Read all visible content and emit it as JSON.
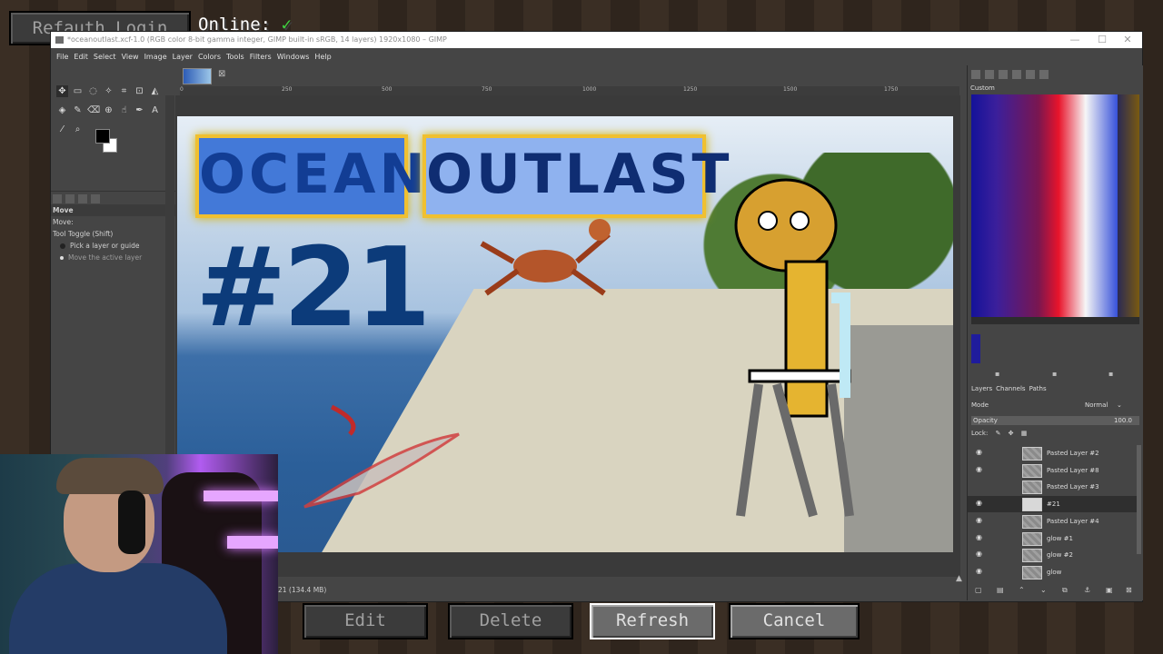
{
  "minecraft": {
    "top_button": "Refauth Login",
    "online_label": "Online:",
    "online_check": "✓",
    "buttons": {
      "edit": "Edit",
      "delete": "Delete",
      "refresh": "Refresh",
      "cancel": "Cancel"
    }
  },
  "gimp": {
    "title": "*oceanoutlast.xcf-1.0 (RGB color 8-bit gamma integer, GIMP built-in sRGB, 14 layers) 1920x1080 – GIMP",
    "window_controls": [
      "—",
      "☐",
      "✕"
    ],
    "menu": [
      "File",
      "Edit",
      "Select",
      "View",
      "Image",
      "Layer",
      "Colors",
      "Tools",
      "Filters",
      "Windows",
      "Help"
    ],
    "tool_options": {
      "header": "Move",
      "move_label": "Move:",
      "toggle": "Tool Toggle (Shift)",
      "opt1": "Pick a layer or guide",
      "opt2": "Move the active layer"
    },
    "ruler_marks": [
      "0",
      "250",
      "500",
      "750",
      "1000",
      "1250",
      "1500",
      "1750"
    ],
    "image": {
      "title_left": "OCEAN",
      "title_right": "OUTLAST",
      "episode": "#21"
    },
    "status": "21 (134.4 MB)",
    "gradient": {
      "label": "Custom"
    },
    "layers_panel": {
      "tabs": [
        "Layers",
        "Channels",
        "Paths"
      ],
      "mode_label": "Mode",
      "mode_value": "Normal",
      "opacity_label": "Opacity",
      "opacity_value": "100.0",
      "opacity_fraction": 1.0,
      "lock_label": "Lock:",
      "layers": [
        {
          "name": "Pasted Layer #2",
          "visible": true,
          "selected": false
        },
        {
          "name": "Pasted Layer #8",
          "visible": true,
          "selected": false
        },
        {
          "name": "Pasted Layer #3",
          "visible": false,
          "selected": false
        },
        {
          "name": "#21",
          "visible": true,
          "selected": true
        },
        {
          "name": "Pasted Layer #4",
          "visible": true,
          "selected": false
        },
        {
          "name": "glow #1",
          "visible": true,
          "selected": false
        },
        {
          "name": "glow #2",
          "visible": true,
          "selected": false
        },
        {
          "name": "glow",
          "visible": true,
          "selected": false
        }
      ]
    }
  },
  "colors": {
    "accent_title_border": "#f0c030",
    "episode_text": "#0c3b7a",
    "minecraft_button": "#6b6b6b"
  }
}
